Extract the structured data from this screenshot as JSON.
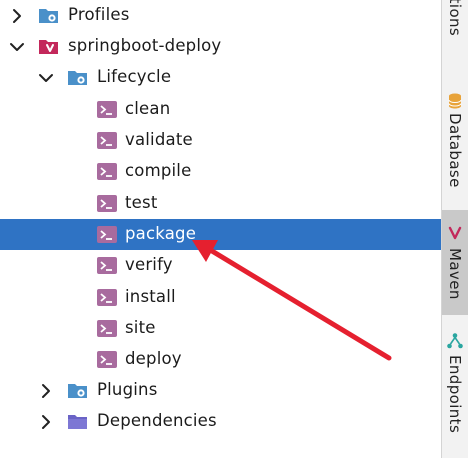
{
  "tree": {
    "profiles": "Profiles",
    "project": "springboot-deploy",
    "lifecycle": "Lifecycle",
    "phases": [
      "clean",
      "validate",
      "compile",
      "test",
      "package",
      "verify",
      "install",
      "site",
      "deploy"
    ],
    "selected_phase": "package",
    "plugins": "Plugins",
    "dependencies": "Dependencies"
  },
  "sidebar": {
    "tabs": [
      "ations",
      "Database",
      "Maven",
      "Endpoints"
    ],
    "active_tab": "Maven"
  },
  "colors": {
    "selection": "#2f73c4",
    "folder": "#4a90c9",
    "phase_icon": "#a86b9e",
    "maven": "#c3285b",
    "annotation_arrow": "#e5202f"
  },
  "icons": {
    "expand": "chevron-right-icon",
    "collapse": "chevron-down-icon",
    "profiles": "folder-gear-icon",
    "project": "maven-module-icon",
    "lifecycle": "folder-gear-icon",
    "phase": "run-config-icon",
    "plugins": "folder-gear-icon",
    "dependencies": "folder-icon",
    "database": "database-icon",
    "maven": "maven-icon",
    "endpoints": "endpoints-icon"
  }
}
